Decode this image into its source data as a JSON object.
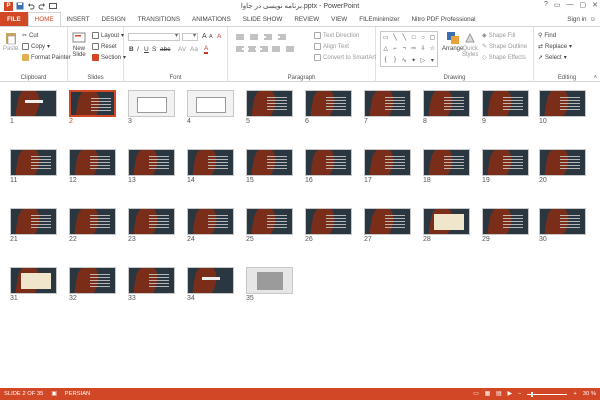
{
  "window": {
    "title": "برنامه نویسی در جاوا.pptx - PowerPoint",
    "controls": [
      "?",
      "▭",
      "—",
      "▢",
      "✕"
    ]
  },
  "tabs": [
    {
      "label": "FILE"
    },
    {
      "label": "HOME"
    },
    {
      "label": "INSERT"
    },
    {
      "label": "DESIGN"
    },
    {
      "label": "TRANSITIONS"
    },
    {
      "label": "ANIMATIONS"
    },
    {
      "label": "SLIDE SHOW"
    },
    {
      "label": "REVIEW"
    },
    {
      "label": "VIEW"
    },
    {
      "label": "FILEminimizer"
    },
    {
      "label": "Nitro PDF Professional"
    }
  ],
  "signin": "Sign in",
  "ribbon": {
    "clipboard": {
      "label": "Clipboard",
      "paste": "Paste",
      "cut": "Cut",
      "copy": "Copy",
      "format_painter": "Format Painter"
    },
    "slides": {
      "label": "Slides",
      "new_slide": "New",
      "new_slide2": "Slide",
      "layout": "Layout",
      "reset": "Reset",
      "section": "Section"
    },
    "font": {
      "label": "Font",
      "bold": "B",
      "italic": "I",
      "underline": "U",
      "shadow": "S",
      "strike": "abc",
      "grow": "A",
      "shrink": "A",
      "clear": "A"
    },
    "paragraph": {
      "label": "Paragraph",
      "text_direction": "Text Direction",
      "align_text": "Align Text",
      "convert_smartart": "Convert to SmartArt"
    },
    "drawing": {
      "label": "Drawing",
      "arrange": "Arrange",
      "quick_styles": "Quick",
      "quick_styles2": "Styles",
      "shape_fill": "Shape Fill",
      "shape_outline": "Shape Outline",
      "shape_effects": "Shape Effects"
    },
    "editing": {
      "label": "Editing",
      "find": "Find",
      "replace": "Replace",
      "select": "Select"
    }
  },
  "slides": [
    "1",
    "2",
    "3",
    "4",
    "5",
    "6",
    "7",
    "8",
    "9",
    "10",
    "11",
    "12",
    "13",
    "14",
    "15",
    "16",
    "17",
    "18",
    "19",
    "20",
    "21",
    "22",
    "23",
    "24",
    "25",
    "26",
    "27",
    "28",
    "29",
    "30",
    "31",
    "32",
    "33",
    "34",
    "35"
  ],
  "status": {
    "slide": "SLIDE 2 OF 35",
    "language": "PERSIAN",
    "zoom": "30 %"
  }
}
